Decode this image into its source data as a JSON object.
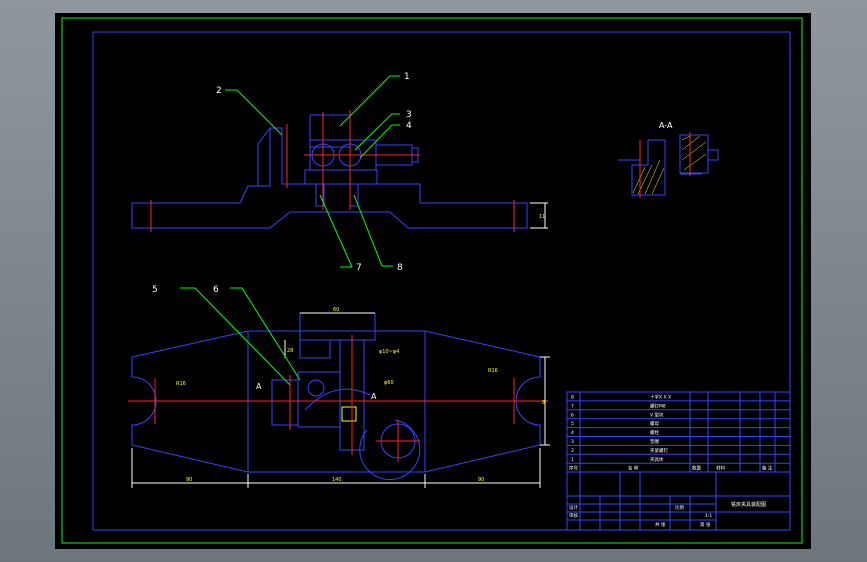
{
  "drawing": {
    "colors": {
      "background": "#000000",
      "viewport": "#8c949b",
      "outline": "#3344ff",
      "frame": "#00ff00",
      "leaders": "#00ff00",
      "centerline": "#ff2222",
      "text": "#ffff00",
      "table_text": "#ffffff",
      "labels": "#ffffff"
    },
    "part_labels": [
      "1",
      "2",
      "3",
      "4",
      "5",
      "6",
      "7",
      "8"
    ],
    "section_label": "A-A",
    "section_marks": [
      "A",
      "A"
    ],
    "dimensions": {
      "top_width": "60",
      "small_height": "28",
      "hole_note": "φ10~φ4",
      "diameter_large": "φ60",
      "radius_small": "R16",
      "diameter_right": "R16",
      "height_right": "8",
      "height_top_view": "11",
      "bottom_left": "90",
      "bottom_mid": "140",
      "bottom_right": "90"
    },
    "bom": {
      "rows": [
        {
          "no": "8",
          "name": "十字X X X"
        },
        {
          "no": "7",
          "name": "螺钉M8"
        },
        {
          "no": "6",
          "name": "V 型块"
        },
        {
          "no": "5",
          "name": "螺母"
        },
        {
          "no": "4",
          "name": "螺栓"
        },
        {
          "no": "3",
          "name": "垫圈"
        },
        {
          "no": "2",
          "name": "夹紧螺钉"
        },
        {
          "no": "1",
          "name": "夹具体"
        }
      ],
      "header": [
        "序号",
        "名 称",
        "数量",
        "材料",
        "备 注"
      ]
    },
    "title_block": {
      "title": "铣床夹具装配图",
      "scale": "1:1",
      "sheet": "第 张",
      "labels": [
        "设计",
        "审核",
        "比例",
        "共 张"
      ]
    }
  }
}
